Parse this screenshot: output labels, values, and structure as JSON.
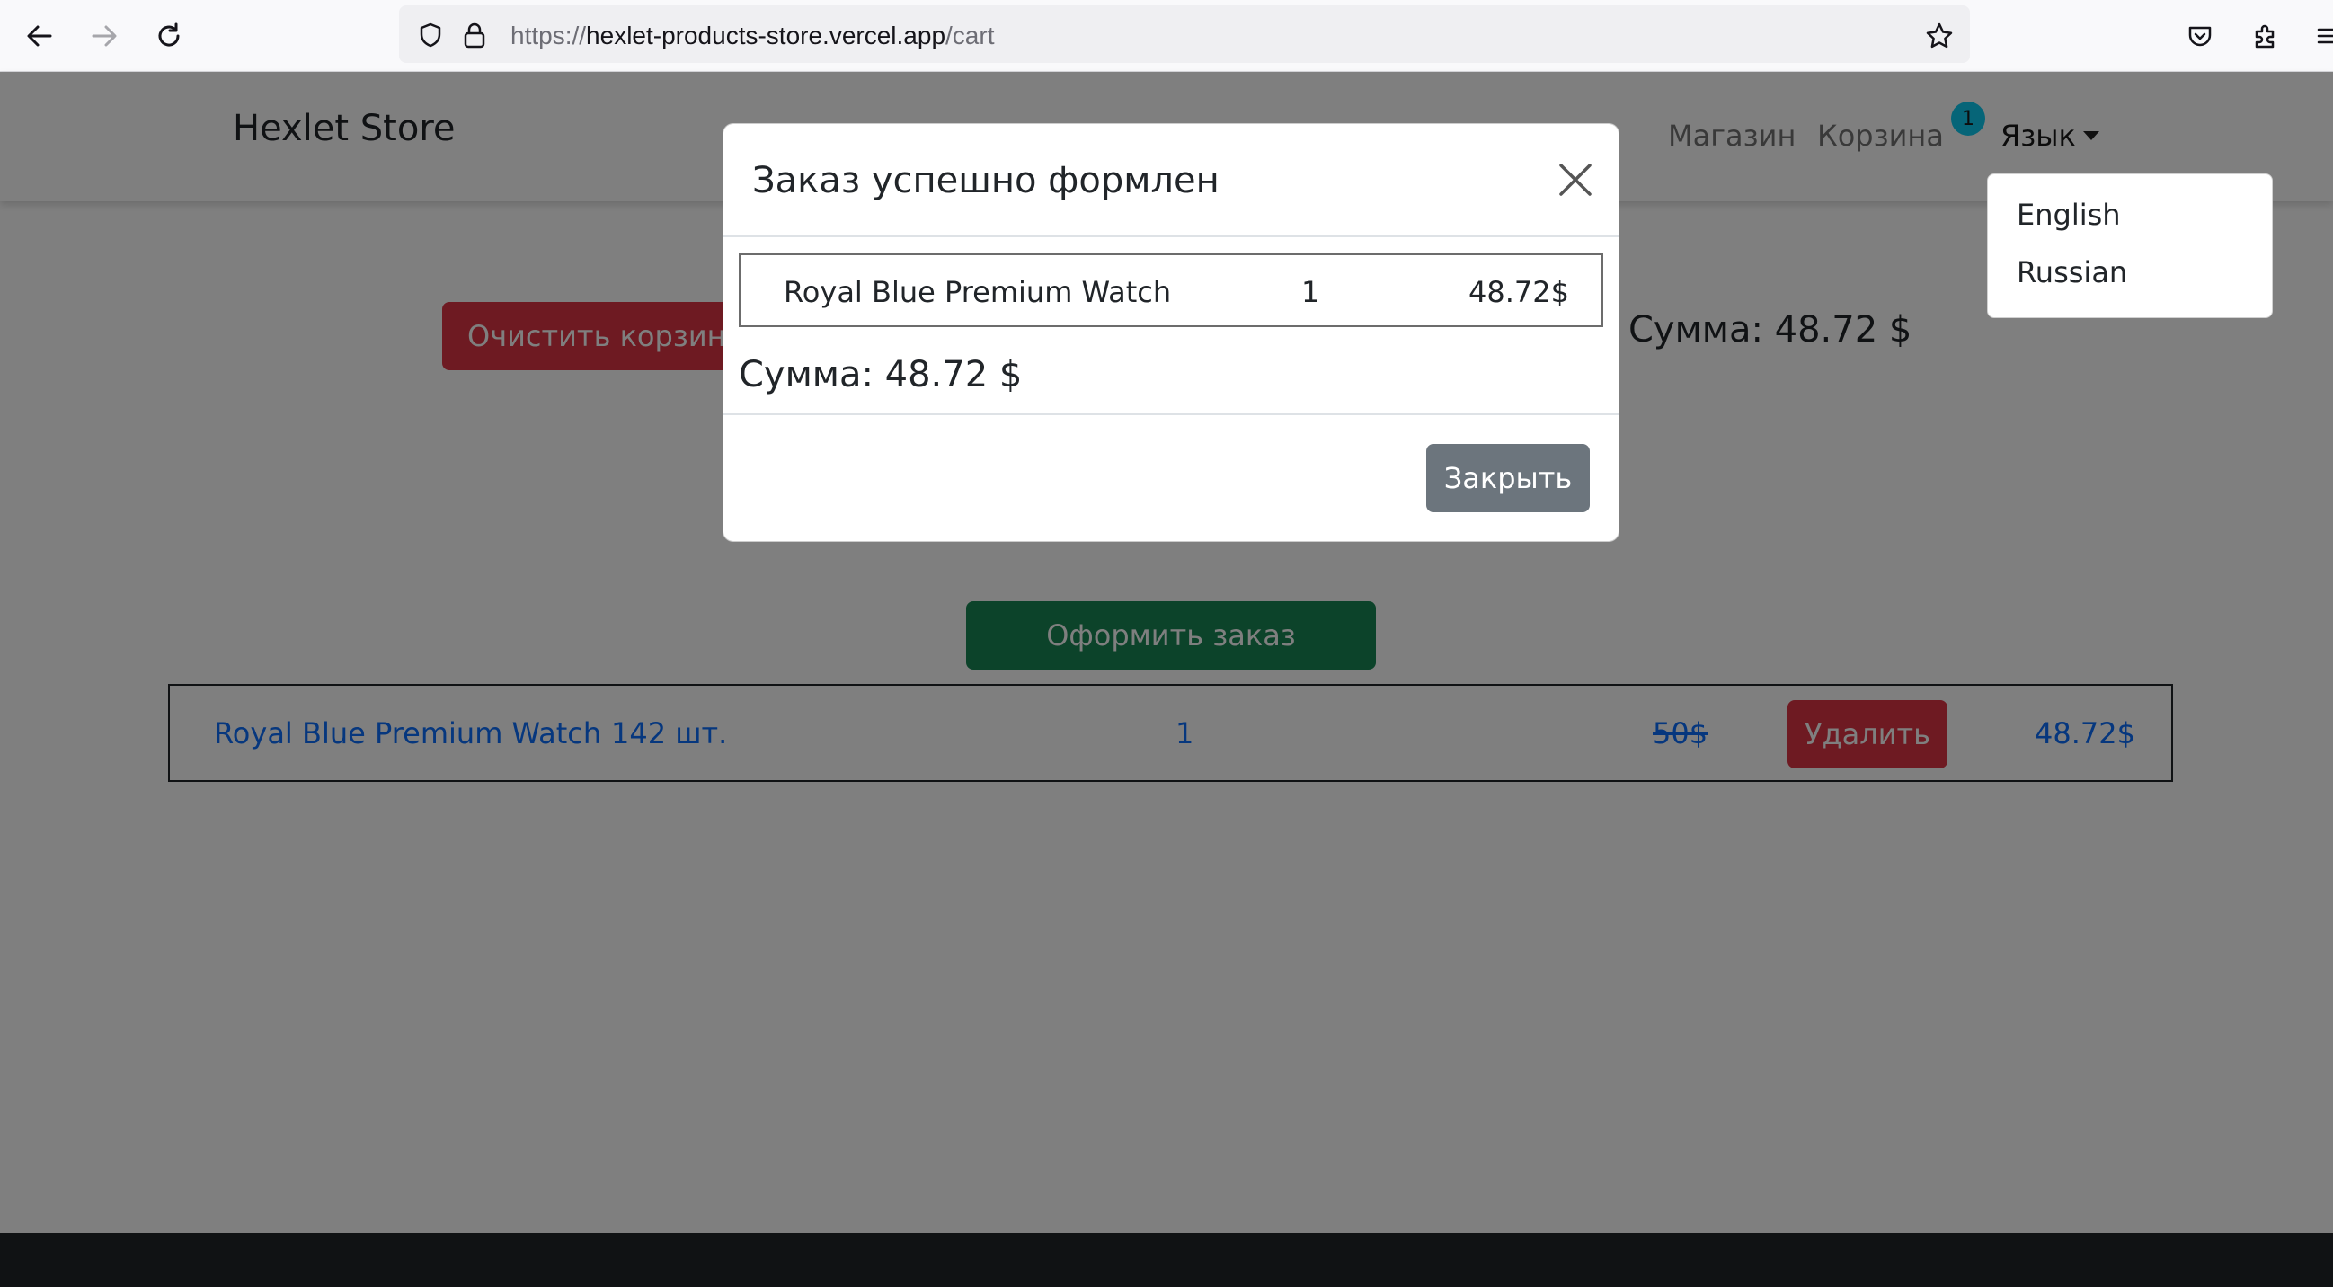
{
  "browser": {
    "url_prefix": "https://",
    "url_host": "hexlet-products-store.vercel.app",
    "url_path": "/cart"
  },
  "navbar": {
    "brand": "Hexlet Store",
    "links": [
      "Магазин",
      "Корзина"
    ],
    "cart_count": "1",
    "language_label": "Язык"
  },
  "language_menu": {
    "options": [
      "English",
      "Russian"
    ]
  },
  "cart": {
    "clear_button": "Очистить корзину",
    "sum": "Сумма: 48.72 $",
    "order_button": "Оформить заказ",
    "items": [
      {
        "name": "Royal Blue Premium Watch",
        "stock": "142 шт.",
        "quantity": "1",
        "old_price": "50$",
        "delete_button": "Удалить",
        "price": "48.72$"
      }
    ]
  },
  "modal": {
    "title": "Заказ успешно формлен",
    "items": [
      {
        "name": "Royal Blue Premium Watch",
        "quantity": "1",
        "price": "48.72$"
      }
    ],
    "sum": "Сумма: 48.72 $",
    "close_button": "Закрыть"
  },
  "colors": {
    "danger": "#dc3545",
    "success": "#198754",
    "secondary": "#6c757d",
    "link": "#0d6efd",
    "badge": "#0dcaf0"
  }
}
